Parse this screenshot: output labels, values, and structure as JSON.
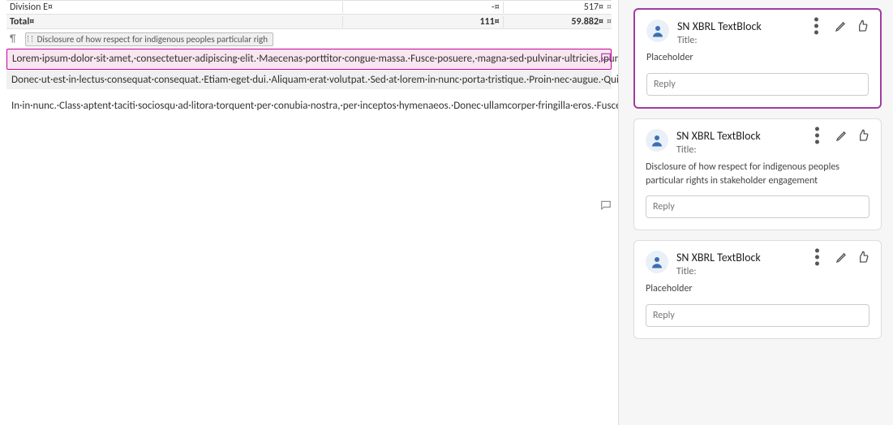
{
  "table": {
    "row1_label": "Division E¤",
    "row1_col1": "-¤",
    "row1_col2": "517¤",
    "row1_end": "¤",
    "total_label": "Total¤",
    "total_col1": "111¤",
    "total_col2": "59.882¤",
    "total_end": "¤"
  },
  "paragraph_mark": "¶",
  "tag": {
    "label": "Disclosure of how respect for indigenous peoples particular righ"
  },
  "blocks": {
    "pink": "Lorem·ipsum·dolor·sit·amet,·consectetuer·adipiscing·elit.·Maecenas·porttitor·congue·massa.·Fusce·posuere,·magna·sed·pulvinar·ultricies,·purus·lectus·malesuada·libero,·sit·amet·commodo·magna·eros·quis·urna.·Nunc·viverra·imperdiet·enim.·Fusce·est.·Vivamus·a·tellus.·Pellentesque·habitant·morbi·tristique·senectus·et·netus·et·malesuada·fames·ac·turpis·egestas.·Proin·pharetra·nonummy·pede.·Mauris·et·orci.·Aenean·nec·lorem.·In·porttitor.·Donec·laoreet·nonummy·augue.·Suspendisse·dui·purus,·scelerisque·at,·vulputate·vitae,·pretium·mattis,·nunc.·Mauris·eget·neque·at·sem·venenatis·eleifend.·Ut·nonummy.·Fusce·aliquet·pede·non·pede.·Suspendisse·dapibus·lorem·pellentesque·magna.·Integer·nulla.·Donec·blandit·feugiat·ligula.·Donec·hendrerit,·felis·et·imperdiet·euismod,·purus·ipsum·pretium·metus,·in·lacinia·nulla·nisl·eget·sapien.¶",
    "gray": "Donec·ut·est·in·lectus·consequat·consequat.·Etiam·eget·dui.·Aliquam·erat·volutpat.·Sed·at·lorem·in·nunc·porta·tristique.·Proin·nec·augue.·Quisque·aliquam·tempor·magna.·Pellentesque·habitant·morbi·tristique·senectus·et·netus·et·malesuada·fames·ac·turpis·egestas.·Nunc·ac·magna.·Maecenas·odio·dolor,·vulputate·vel,·auctor·ac,·accumsan·id,·felis.·Pellentesque·cursus·sagittis·felis.·Pellentesque·porttitor,·velit·lacinia·egestas·auctor,·diam·eros·tempus·arcu,·nec·vulputate·augue·magna·vel·risus.·Cras·non·magna·vel·ante·adipiscing·rhoncus.·Vivamus·a·mi.·Morbi·neque.·Aliquam·erat·volutpat.·Integer·ultrices·lobortis·eros.·Pellentesque·habitant·morbi·tristique·senectus·et·netus·et·malesuada·fames·ac·turpis·egestas.·Proin·semper,·ante·vitae·sollicitudin·posuere,·metus·quam·iaculis·nibh,·vitae·scelerisque·nunc·massa·eget·pede.·Sed·velit·urna,·interdum·vel,·ultricies·vel,·faucibus·at,·quam.·Donec·elit·est,·consectetuer·eget,·consequat·quis,·tempus·quis,·wisi.¶",
    "plain": "In·in·nunc.·Class·aptent·taciti·sociosqu·ad·litora·torquent·per·conubia·nostra,·per·inceptos·hymenaeos.·Donec·ullamcorper·fringilla·eros.·Fusce·in·sapien·eu·purus·dapibus·commodo.·Cum·sociis·natoque·penatibus·et·magnis·dis·parturient·montes,·nascetur·ridiculus·mus.·Cras·faucibus·condimentum·odio.·Sed·ac·ligula.·Aliquam·at·eros.·Etiam·at·ligula·et·tellus·ullamcorper·ultrices.·In·fermentum,·lorem·non·cursus·porttitor,·diam·urna·accumsan·lacus,·sed·"
  },
  "comments": {
    "c1": {
      "author": "SN XBRL TextBlock",
      "title_label": "Title:",
      "body": "Placeholder",
      "reply_placeholder": "Reply"
    },
    "c2": {
      "author": "SN XBRL TextBlock",
      "title_label": "Title:",
      "body": "Disclosure of how respect for indigenous peoples particular rights in stakeholder engagement",
      "reply_placeholder": "Reply"
    },
    "c3": {
      "author": "SN XBRL TextBlock",
      "title_label": "Title:",
      "body": "Placeholder",
      "reply_placeholder": "Reply"
    }
  },
  "icons": {
    "dots": "• • •"
  }
}
